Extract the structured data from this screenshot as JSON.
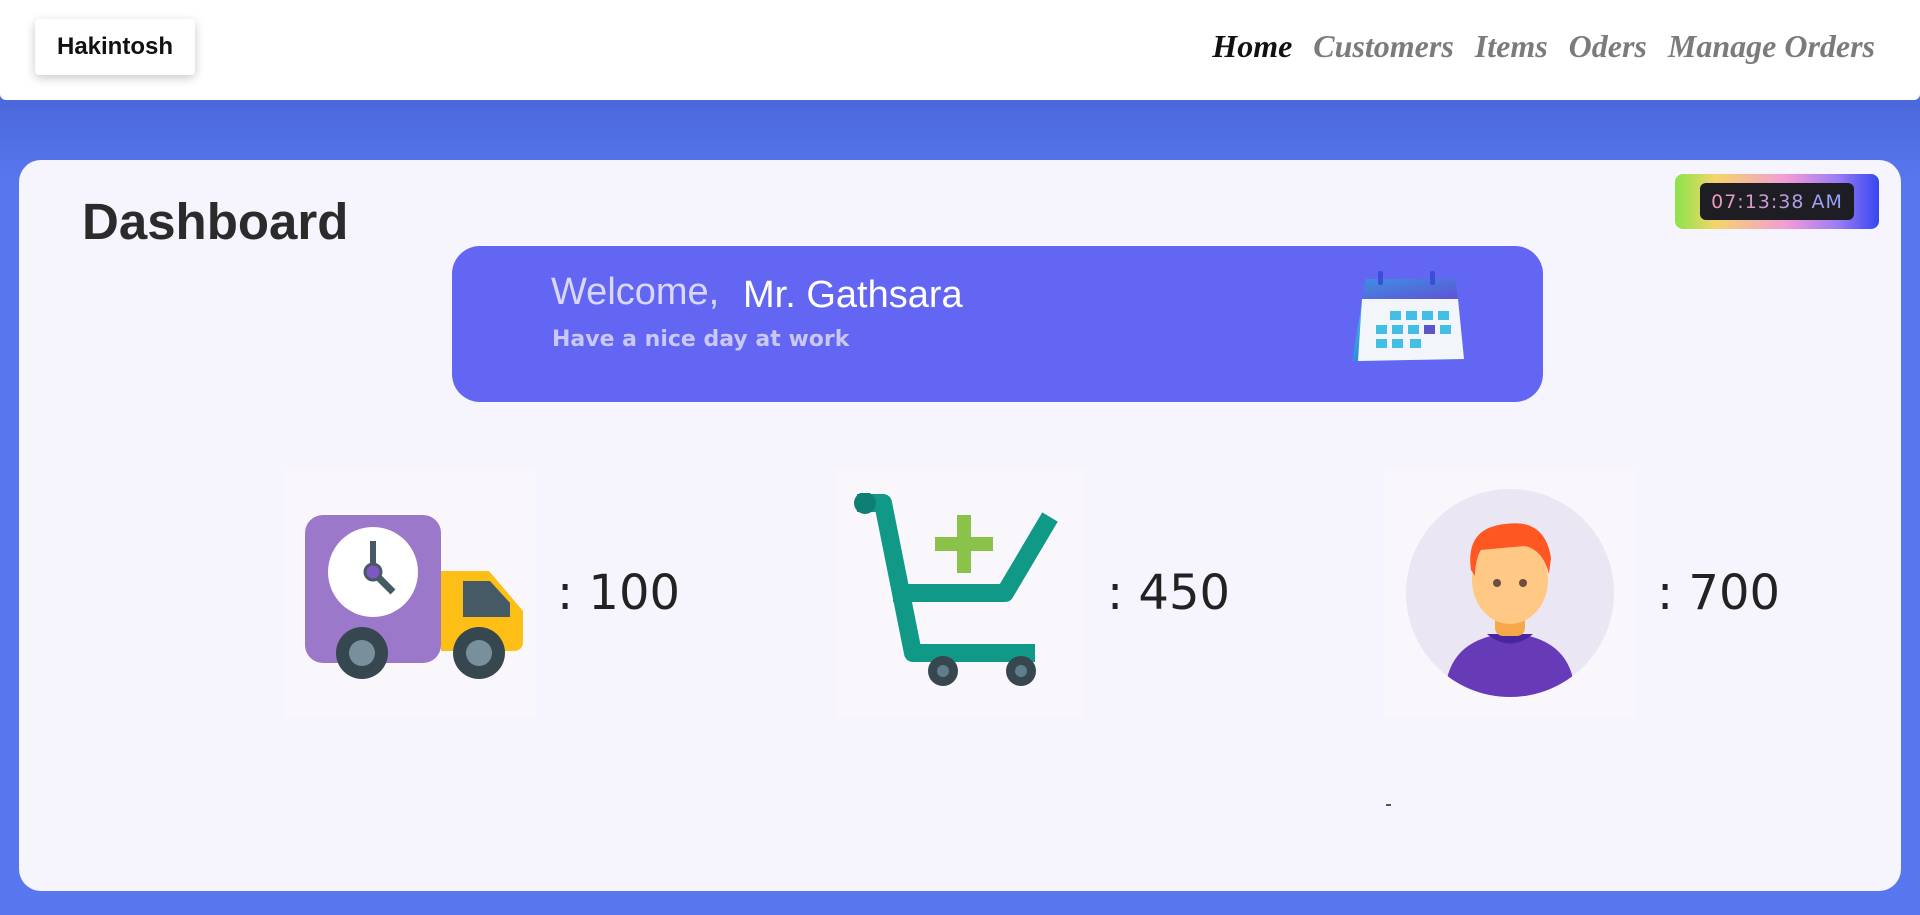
{
  "header": {
    "brand": "Hakintosh",
    "nav": [
      {
        "label": "Home",
        "active": true
      },
      {
        "label": "Customers",
        "active": false
      },
      {
        "label": "Items",
        "active": false
      },
      {
        "label": "Oders",
        "active": false
      },
      {
        "label": "Manage Orders",
        "active": false
      }
    ]
  },
  "dashboard": {
    "title": "Dashboard",
    "clock": "07:13:38 AM",
    "welcome": {
      "greeting": "Welcome,",
      "name": "Mr. Gathsara",
      "subtitle": "Have a nice day at work",
      "icon": "calendar-icon"
    },
    "stats": [
      {
        "icon": "delivery-truck-icon",
        "value": ": 100"
      },
      {
        "icon": "add-to-cart-icon",
        "value": ": 450"
      },
      {
        "icon": "customer-avatar-icon",
        "value": ": 700"
      }
    ]
  },
  "colors": {
    "background": "#5877ee",
    "card": "#f6f4fd",
    "welcome_banner": "#6366f3"
  }
}
